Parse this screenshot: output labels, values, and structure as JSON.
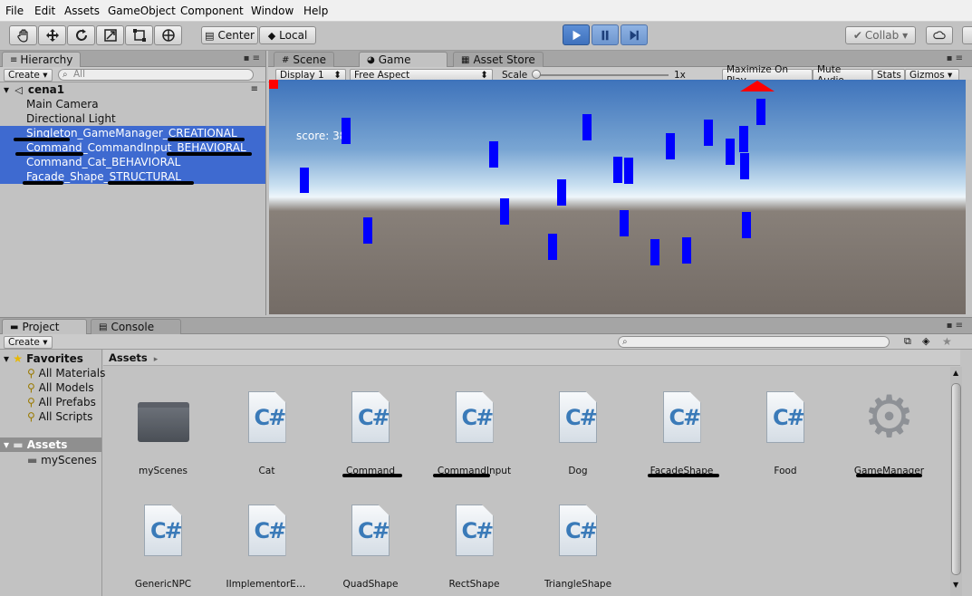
{
  "menubar": {
    "items": [
      "File",
      "Edit",
      "Assets",
      "GameObject",
      "Component",
      "Window",
      "Help"
    ]
  },
  "toolbar": {
    "pivot_label": "Center",
    "space_label": "Local",
    "collab_label": "Collab ▾",
    "tools": [
      "hand-icon",
      "move-icon",
      "rotate-icon",
      "scale-icon",
      "rect-icon",
      "transform-icon"
    ]
  },
  "hierarchy": {
    "tab": "Hierarchy",
    "create": "Create ▾",
    "search_placeholder": "All",
    "scene": "cena1",
    "items": [
      {
        "label": "Main Camera",
        "selected": false
      },
      {
        "label": "Directional Light",
        "selected": false
      },
      {
        "label": "Singleton_GameManager_CREATIONAL",
        "selected": true
      },
      {
        "label": "Command_CommandInput_BEHAVIORAL",
        "selected": true
      },
      {
        "label": "Command_Cat_BEHAVIORAL",
        "selected": true
      },
      {
        "label": "Facade_Shape_STRUCTURAL",
        "selected": true
      }
    ]
  },
  "viewtabs": {
    "scene": "Scene",
    "game": "Game",
    "asset_store": "Asset Store"
  },
  "gamebar": {
    "display": "Display 1",
    "aspect": "Free Aspect",
    "scale_label": "Scale",
    "scale_value": "1x",
    "maximize": "Maximize On Play",
    "mute": "Mute Audio",
    "stats": "Stats",
    "gizmos": "Gizmos ▾"
  },
  "game": {
    "score_text": "score: 38"
  },
  "project": {
    "tab": "Project",
    "console_tab": "Console",
    "create": "Create ▾",
    "breadcrumb": "Assets",
    "favorites_label": "Favorites",
    "favorites": [
      "All Materials",
      "All Models",
      "All Prefabs",
      "All Scripts"
    ],
    "assets_label": "Assets",
    "folders": [
      "myScenes"
    ],
    "grid": [
      {
        "label": "myScenes",
        "kind": "folder"
      },
      {
        "label": "Cat",
        "kind": "script"
      },
      {
        "label": "Command",
        "kind": "script"
      },
      {
        "label": "CommandInput",
        "kind": "script"
      },
      {
        "label": "Dog",
        "kind": "script"
      },
      {
        "label": "FacadeShape",
        "kind": "script"
      },
      {
        "label": "Food",
        "kind": "script"
      },
      {
        "label": "GameManager",
        "kind": "gear"
      },
      {
        "label": "GenericNPC",
        "kind": "script"
      },
      {
        "label": "IImplementorEle...",
        "kind": "script"
      },
      {
        "label": "QuadShape",
        "kind": "script"
      },
      {
        "label": "RectShape",
        "kind": "script"
      },
      {
        "label": "TriangleShape",
        "kind": "script"
      }
    ]
  },
  "colors": {
    "selection": "#3e6ad0",
    "cube": "#0000ff",
    "play_active": "#4a7fcc"
  }
}
